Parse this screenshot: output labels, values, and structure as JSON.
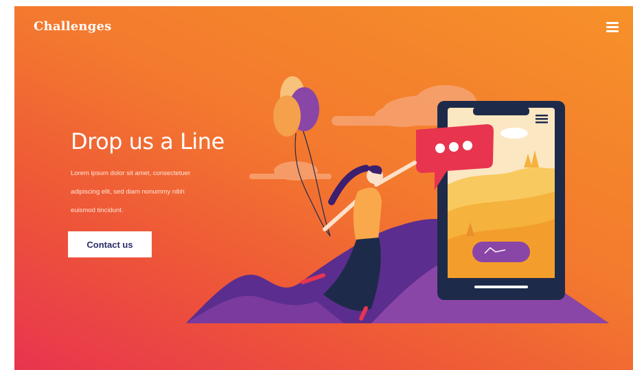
{
  "header": {
    "brand": "Challenges",
    "menu_icon": "hamburger-menu-icon"
  },
  "hero": {
    "heading": "Drop us a Line",
    "body_lines": [
      "Lorem ipsum dolor sit amet, consectetuer",
      "adipiscing elit, sed diam nonummy nibh",
      "euismod tincidunt."
    ],
    "cta_label": "Contact us"
  },
  "colors": {
    "gradient_start": "#e8344f",
    "gradient_end": "#f69129",
    "mountain": "#5b2d8e",
    "phone_frame": "#1e2a4a",
    "chat_bubble": "#e8344f",
    "phone_button": "#8a46a6"
  },
  "illustration": {
    "icons": [
      "balloons-icon",
      "chat-bubble-icon",
      "smartphone-icon",
      "cloud-icon",
      "mountain-icon"
    ]
  }
}
